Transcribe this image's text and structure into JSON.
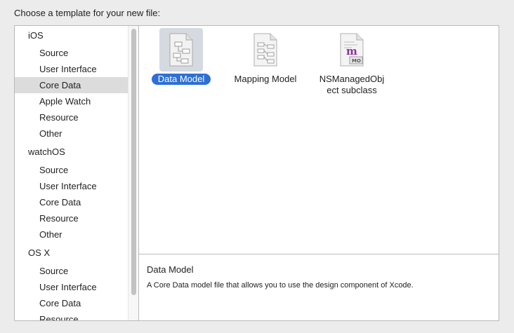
{
  "dialog": {
    "prompt": "Choose a template for your new file:"
  },
  "sidebar": {
    "groups": [
      {
        "label": "iOS",
        "items": [
          "Source",
          "User Interface",
          "Core Data",
          "Apple Watch",
          "Resource",
          "Other"
        ]
      },
      {
        "label": "watchOS",
        "items": [
          "Source",
          "User Interface",
          "Core Data",
          "Resource",
          "Other"
        ]
      },
      {
        "label": "OS X",
        "items": [
          "Source",
          "User Interface",
          "Core Data",
          "Resource"
        ]
      }
    ],
    "selected": "iOS / Core Data"
  },
  "templates": [
    {
      "label": "Data Model",
      "icon": "data-model-icon",
      "selected": true
    },
    {
      "label": "Mapping Model",
      "icon": "mapping-model-icon",
      "selected": false
    },
    {
      "label_line1": "NSManagedObj",
      "label_line2": "ect subclass",
      "icon": "nsmanagedobject-icon",
      "badge": "MO",
      "glyph": "m",
      "selected": false
    }
  ],
  "description": {
    "title": "Data Model",
    "text": "A Core Data model file that allows you to use the design component of Xcode."
  },
  "colors": {
    "selection_blue": "#2e6fd6",
    "sidebar_selected": "#dcdcdc",
    "mo_purple": "#8b2f9c"
  }
}
